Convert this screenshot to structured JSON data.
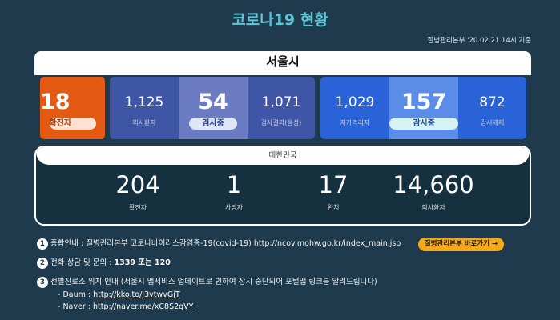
{
  "page_title": "코로나19 현황",
  "reference": "질병관리본부 '20.02.21.14시 기준",
  "seoul": {
    "name": "서울시",
    "confirmed": {
      "value": "18",
      "label": "확진자"
    },
    "checking_group": [
      {
        "value": "1,125",
        "label": "의사환자"
      },
      {
        "value": "54",
        "label": "검사중"
      },
      {
        "value": "1,071",
        "label": "검사결과(음성)"
      }
    ],
    "self_group": [
      {
        "value": "1,029",
        "label": "자가격리자"
      },
      {
        "value": "157",
        "label": "감시중"
      },
      {
        "value": "872",
        "label": "감시해제"
      }
    ]
  },
  "korea": {
    "name": "대한민국",
    "stats": [
      {
        "value": "204",
        "label": "확진자"
      },
      {
        "value": "1",
        "label": "사망자"
      },
      {
        "value": "17",
        "label": "완치"
      },
      {
        "value": "14,660",
        "label": "의사환자"
      }
    ]
  },
  "notes": {
    "n1": {
      "num": "1",
      "text": "종합안내 : 질병관리본부 코로나바이러스감염증-19(covid-19)  http://ncov.mohw.go.kr/index_main.jsp",
      "button": "질병관리본부 바로가기 →"
    },
    "n2": {
      "num": "2",
      "prefix": "전화 상담 및 문의 : ",
      "bold": "1339 또는 120"
    },
    "n3": {
      "num": "3",
      "text": "선별진료소 위치 안내 (서울시 맵서비스 업데이트로 인하여 잠시 중단되어 포털맵 링크를 알려드립니다)",
      "daum_label": "- Daum : ",
      "daum_link": "http://kko.to/J3vtwvGjT",
      "naver_label": "- Naver : ",
      "naver_link": "http://naver.me/xC8S2gVY"
    }
  },
  "colors": {
    "background": "#1e3a4c",
    "title": "#5bc6d8",
    "confirmed_tile": "#e55a12",
    "checking_tile": "#3f55a6",
    "self_tile": "#2a62d7",
    "button": "#f2a91e"
  }
}
